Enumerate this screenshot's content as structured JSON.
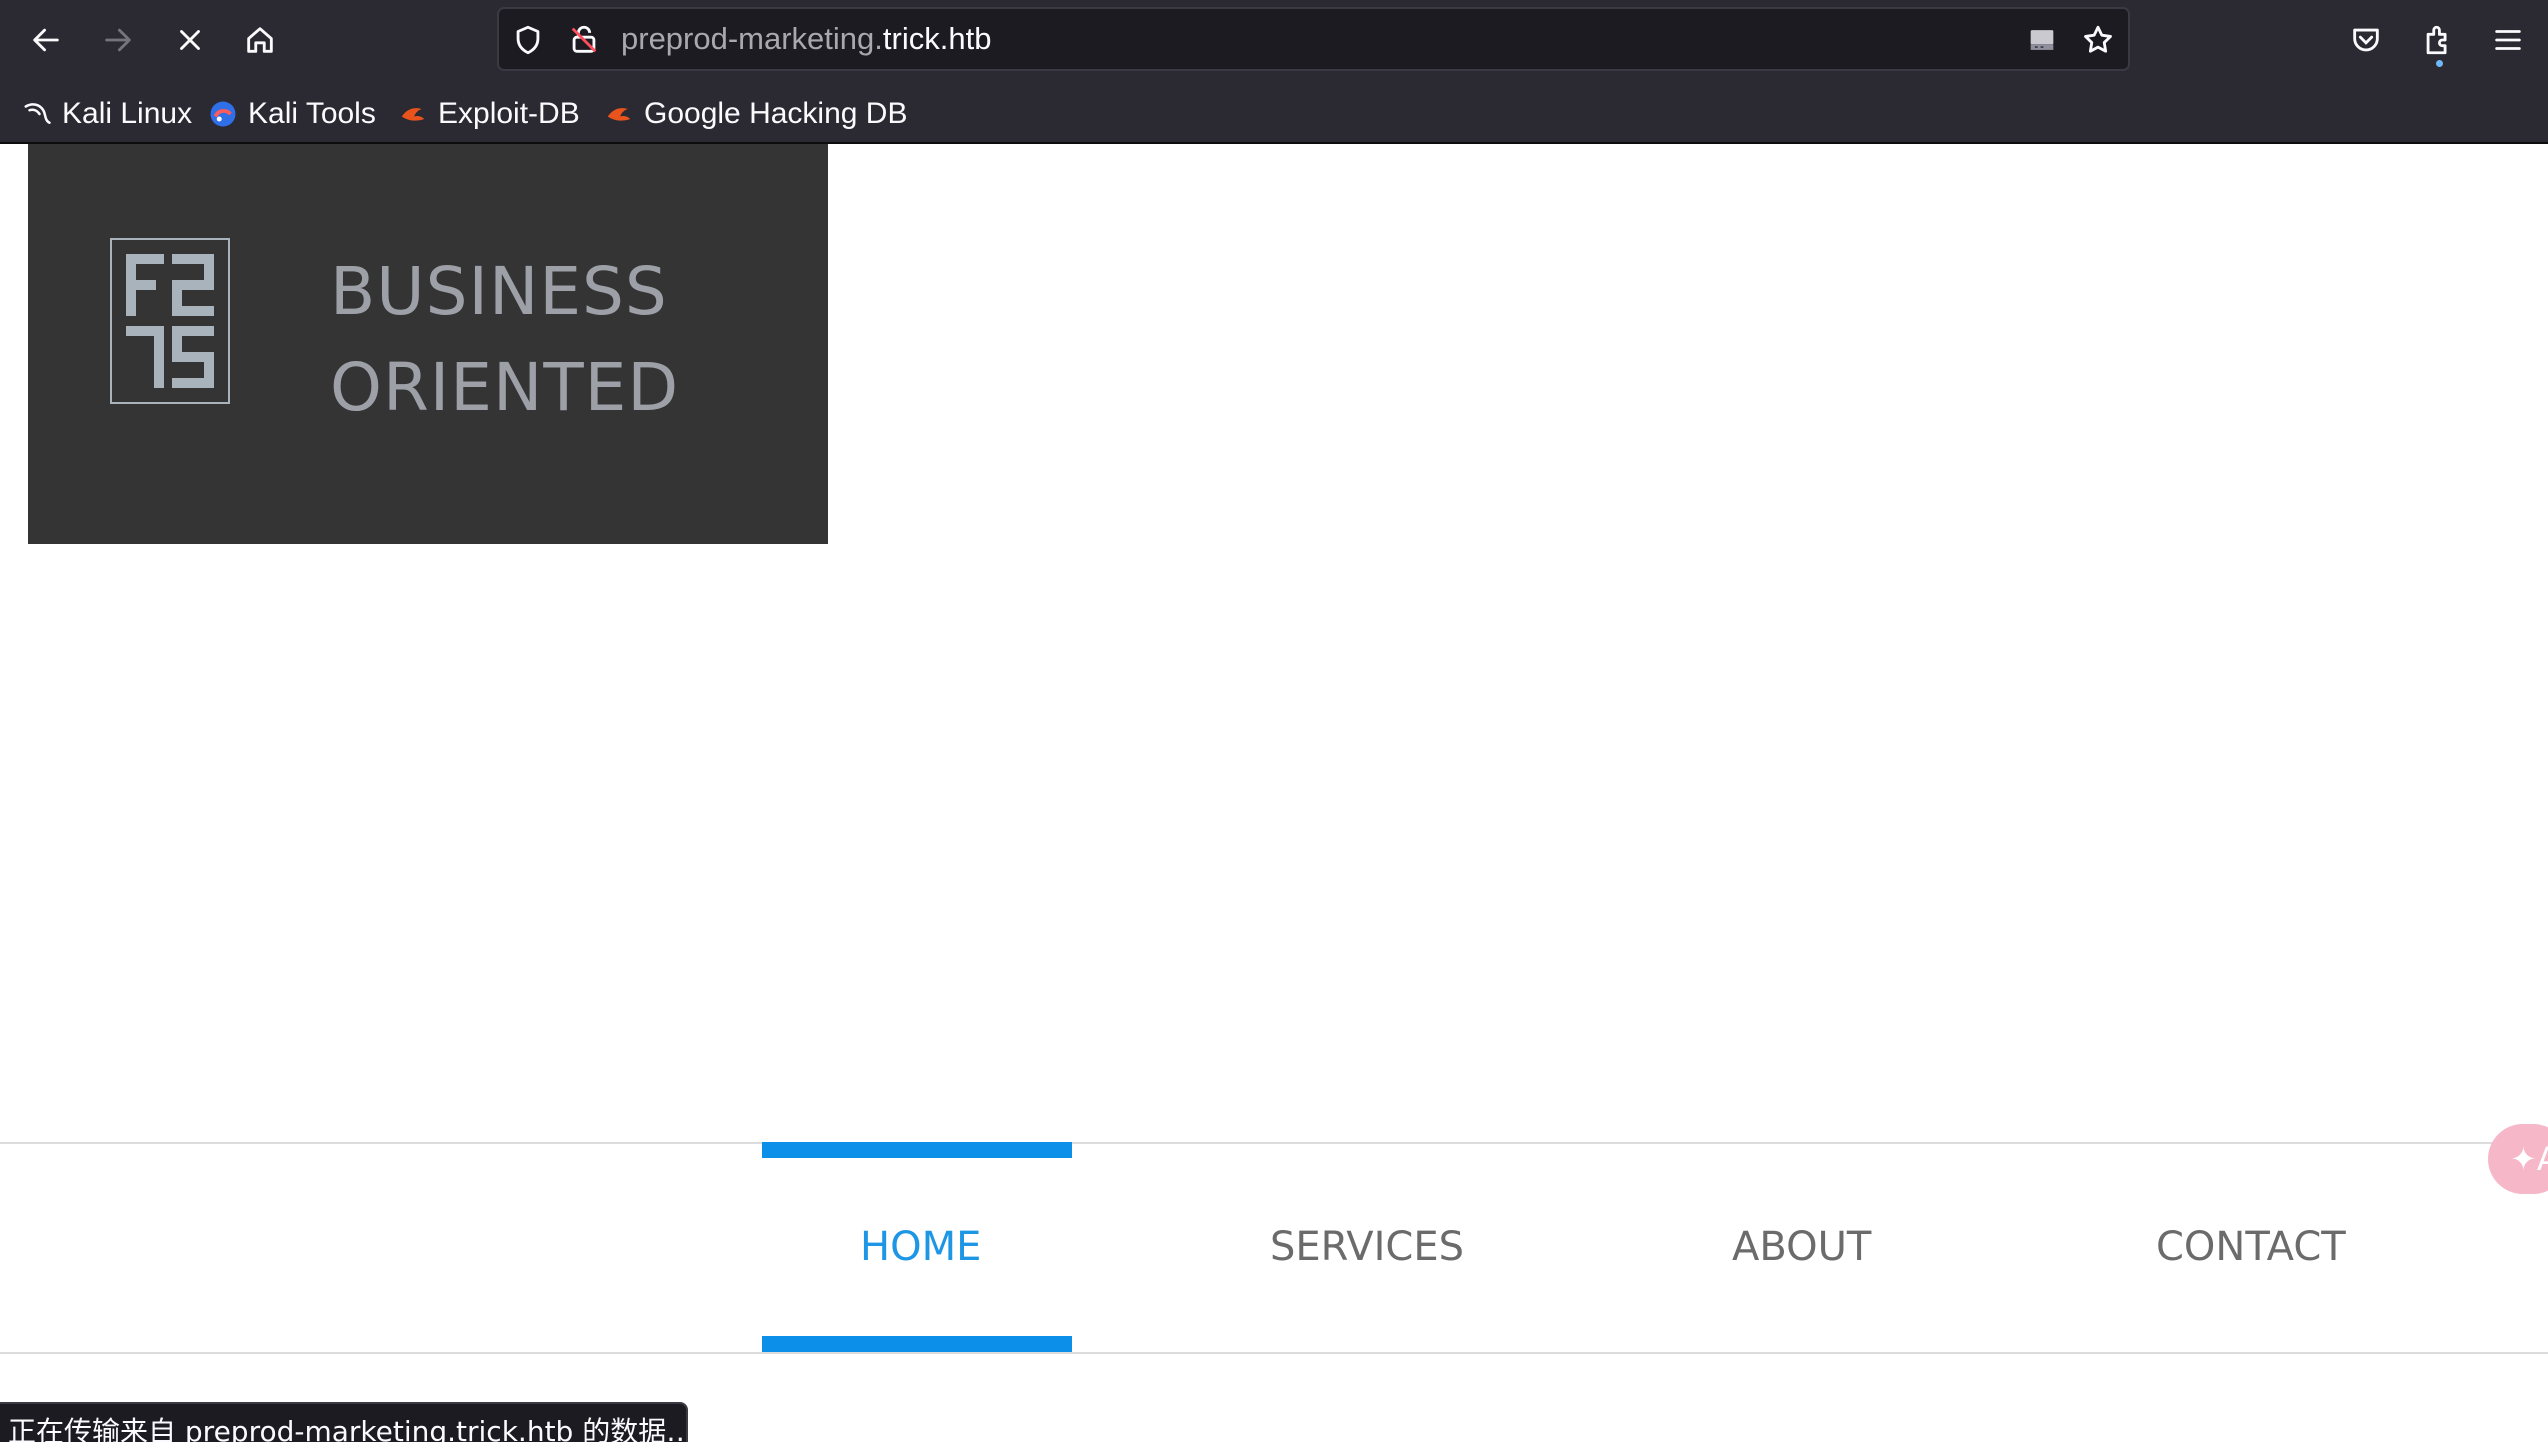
{
  "browser": {
    "url_prefix": "preprod-marketing.",
    "url_domain": "trick.htb",
    "bookmarks": [
      {
        "label": "Kali Linux",
        "icon": "kali-dragon-icon"
      },
      {
        "label": "Kali Tools",
        "icon": "kali-tools-icon"
      },
      {
        "label": "Exploit-DB",
        "icon": "exploit-db-icon"
      },
      {
        "label": "Google Hacking DB",
        "icon": "ghdb-icon"
      }
    ],
    "status_text": "正在传输来自 preprod-marketing.trick.htb 的数据…"
  },
  "page": {
    "logo": {
      "line1": "BUSINESS",
      "line2": "ORIENTED",
      "mark_icon": "fz-logo-mark"
    },
    "menu": [
      {
        "label": "HOME",
        "active": true
      },
      {
        "label": "SERVICES",
        "active": false
      },
      {
        "label": "ABOUT",
        "active": false
      },
      {
        "label": "CONTACT",
        "active": false
      }
    ],
    "translate_badge": "✦A"
  },
  "colors": {
    "chrome_bg": "#2b2a33",
    "logo_box": "#343434",
    "menu_active": "#1e96e6",
    "active_bar": "#0b8fe8"
  }
}
